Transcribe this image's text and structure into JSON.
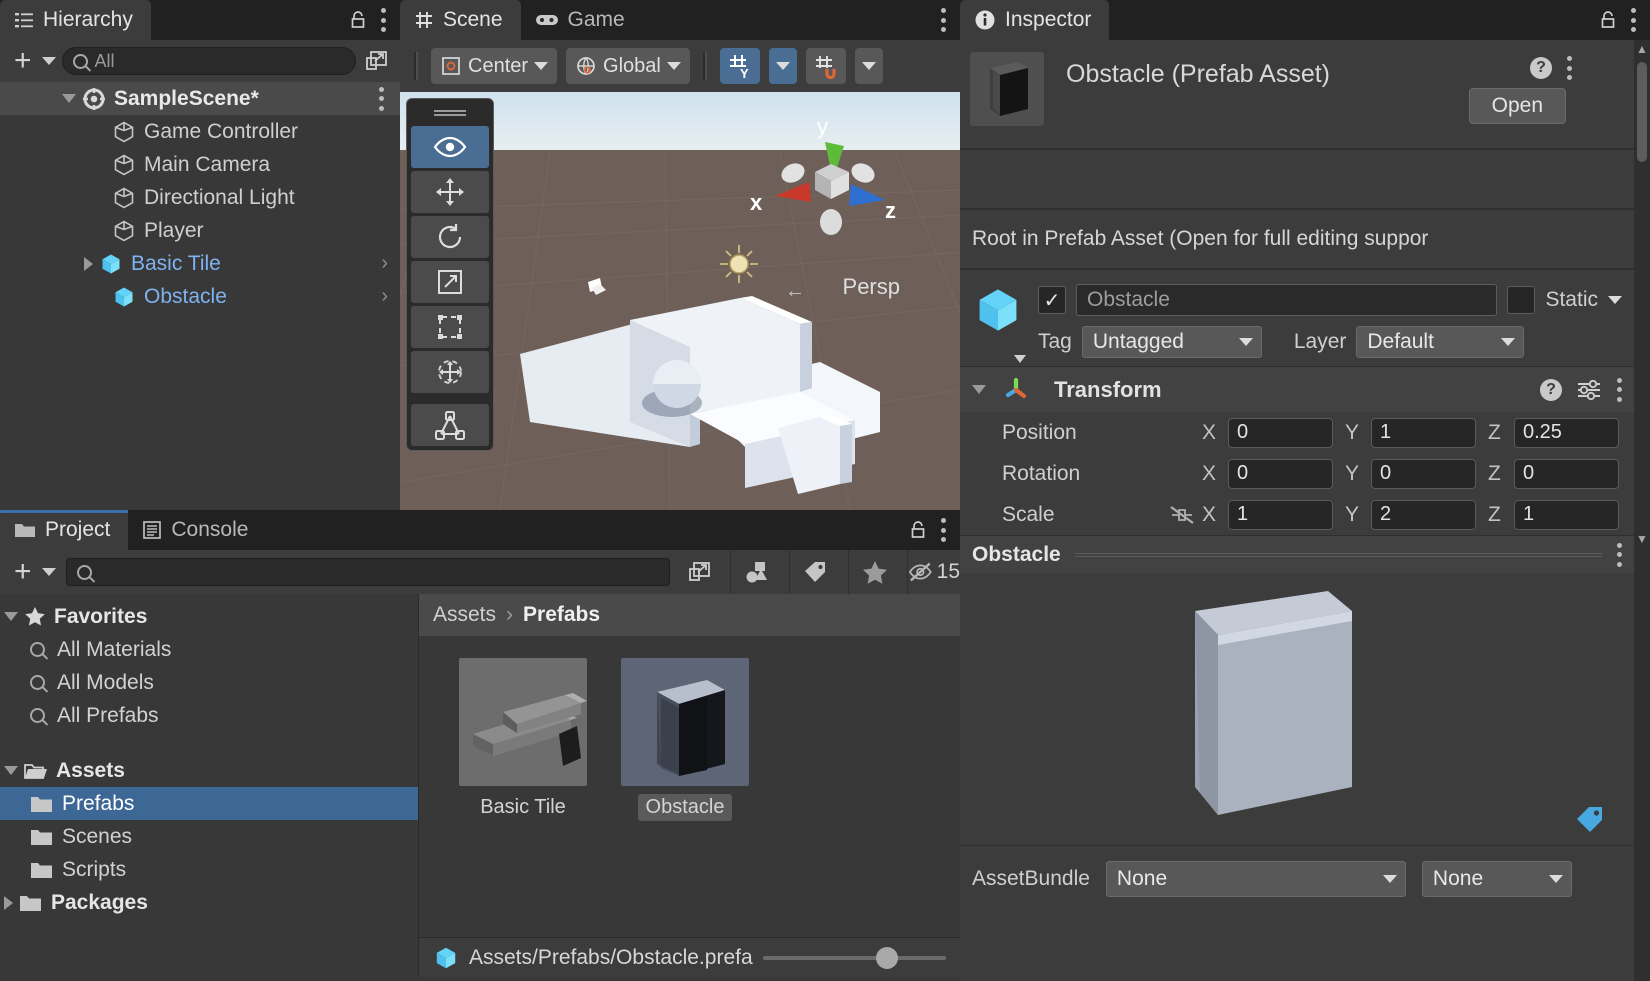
{
  "hierarchy": {
    "tab_label": "Hierarchy",
    "search_placeholder": "All",
    "items": [
      {
        "label": "SampleScene*",
        "icon": "scene-icon",
        "depth": 0,
        "selected_row": true,
        "expanded": true
      },
      {
        "label": "Game Controller",
        "icon": "gameobject-icon",
        "depth": 1
      },
      {
        "label": "Main Camera",
        "icon": "gameobject-icon",
        "depth": 1
      },
      {
        "label": "Directional Light",
        "icon": "gameobject-icon",
        "depth": 1
      },
      {
        "label": "Player",
        "icon": "gameobject-icon",
        "depth": 1
      },
      {
        "label": "Basic Tile",
        "icon": "prefab-icon",
        "depth": 1,
        "prefab": true,
        "has_children": true
      },
      {
        "label": "Obstacle",
        "icon": "prefab-icon",
        "depth": 1,
        "prefab": true
      }
    ]
  },
  "scene": {
    "tabs": [
      {
        "label": "Scene",
        "icon": "grid-icon",
        "active": true
      },
      {
        "label": "Game",
        "icon": "gamepad-icon",
        "active": false
      }
    ],
    "toolbar": {
      "pivot_mode": "Center",
      "handle_space": "Global",
      "grid_axis": "Y",
      "snap_label": ""
    },
    "gizmo": {
      "x_label": "x",
      "y_label": "y",
      "z_label": "z",
      "projection": "Persp",
      "x_color": "#c8392b",
      "y_color": "#5dbb3a",
      "z_color": "#2f6fd0"
    },
    "tools": [
      {
        "name": "view-tool",
        "active": true
      },
      {
        "name": "move-tool",
        "active": false
      },
      {
        "name": "rotate-tool",
        "active": false
      },
      {
        "name": "scale-tool",
        "active": false
      },
      {
        "name": "rect-tool",
        "active": false
      },
      {
        "name": "transform-tool",
        "active": false
      },
      {
        "name": "custom-editor-tool",
        "active": false
      }
    ]
  },
  "inspector": {
    "tab_label": "Inspector",
    "asset_title": "Obstacle (Prefab Asset)",
    "open_button": "Open",
    "notice": "Root in Prefab Asset (Open for full editing suppor",
    "object": {
      "enabled": true,
      "name_value": "Obstacle",
      "static_label": "Static",
      "static_checked": false,
      "tag_label": "Tag",
      "tag_value": "Untagged",
      "layer_label": "Layer",
      "layer_value": "Default"
    },
    "transform": {
      "title": "Transform",
      "rows": [
        {
          "label": "Position",
          "x": "0",
          "y": "1",
          "z": "0.25"
        },
        {
          "label": "Rotation",
          "x": "0",
          "y": "0",
          "z": "0"
        },
        {
          "label": "Scale",
          "x": "1",
          "y": "2",
          "z": "1",
          "has_lock": true
        }
      ],
      "axis_labels": {
        "x": "X",
        "y": "Y",
        "z": "Z"
      }
    },
    "asset_preview_title": "Obstacle",
    "assetbundle": {
      "label": "AssetBundle",
      "value": "None",
      "variant_value": "None"
    }
  },
  "project": {
    "tabs": [
      {
        "label": "Project",
        "icon": "folder-icon",
        "active": true
      },
      {
        "label": "Console",
        "icon": "console-icon",
        "active": false
      }
    ],
    "search_placeholder": "",
    "hidden_count": "15",
    "tree": [
      {
        "label": "Favorites",
        "depth": 0,
        "icon": "star-icon",
        "bold": true,
        "expanded": true
      },
      {
        "label": "All Materials",
        "depth": 1,
        "icon": "search-icon"
      },
      {
        "label": "All Models",
        "depth": 1,
        "icon": "search-icon"
      },
      {
        "label": "All Prefabs",
        "depth": 1,
        "icon": "search-icon"
      },
      {
        "label": "Assets",
        "depth": 0,
        "icon": "folder-open-icon",
        "bold": true,
        "expanded": true
      },
      {
        "label": "Prefabs",
        "depth": 1,
        "icon": "folder-icon",
        "selected": true
      },
      {
        "label": "Scenes",
        "depth": 1,
        "icon": "folder-icon"
      },
      {
        "label": "Scripts",
        "depth": 1,
        "icon": "folder-icon"
      },
      {
        "label": "Packages",
        "depth": 0,
        "icon": "folder-icon",
        "bold": true,
        "collapsed": true
      }
    ],
    "breadcrumb": [
      "Assets",
      "Prefabs"
    ],
    "assets": [
      {
        "label": "Basic Tile",
        "selected": false,
        "thumb": "basic-tile"
      },
      {
        "label": "Obstacle",
        "selected": true,
        "thumb": "obstacle"
      }
    ],
    "status_path": "Assets/Prefabs/Obstacle.prefa"
  },
  "colors": {
    "accent_blue": "#3d6795",
    "tool_active": "#4a6d94",
    "prefab_blue": "#7fb2f0",
    "panel_bg": "#383838",
    "header_bg": "#212121"
  }
}
